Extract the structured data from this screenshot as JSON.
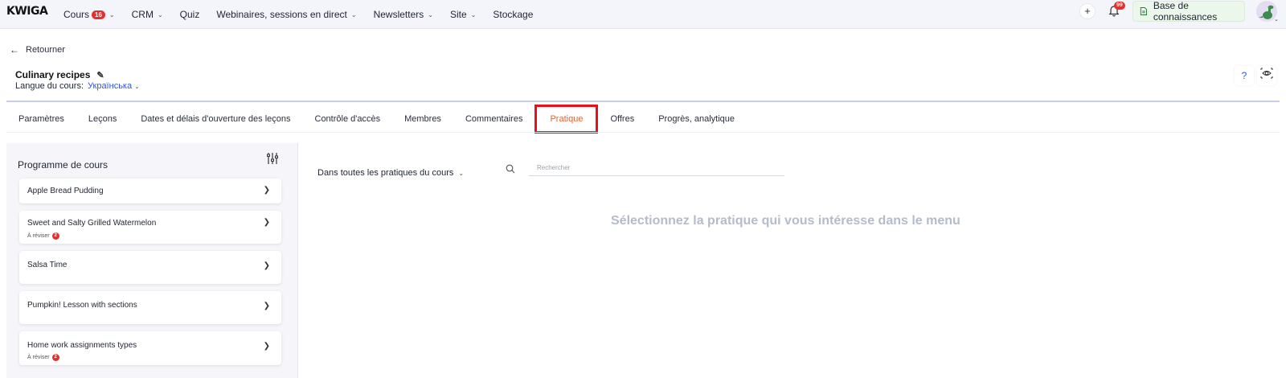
{
  "app": {
    "logo": "KWIGA"
  },
  "nav": {
    "items": [
      {
        "label": "Cours",
        "badge": "16",
        "has_chevron": true
      },
      {
        "label": "CRM",
        "has_chevron": true
      },
      {
        "label": "Quiz",
        "has_chevron": false
      },
      {
        "label": "Webinaires, sessions en direct",
        "has_chevron": true
      },
      {
        "label": "Newsletters",
        "has_chevron": true
      },
      {
        "label": "Site",
        "has_chevron": true
      },
      {
        "label": "Stockage",
        "has_chevron": false
      }
    ],
    "plus_label": "+",
    "notifications_badge": "99",
    "knowledge_base_label": "Base de connaissances"
  },
  "header": {
    "back_label": "Retourner",
    "course_title": "Culinary recipes",
    "language_label": "Langue du cours:",
    "language_value": "Українська",
    "help_label": "?"
  },
  "tabs": [
    {
      "label": "Paramètres",
      "active": false
    },
    {
      "label": "Leçons",
      "active": false
    },
    {
      "label": "Dates et délais d'ouverture des leçons",
      "active": false
    },
    {
      "label": "Contrôle d'accès",
      "active": false
    },
    {
      "label": "Membres",
      "active": false
    },
    {
      "label": "Commentaires",
      "active": false
    },
    {
      "label": "Pratique",
      "active": true
    },
    {
      "label": "Offres",
      "active": false
    },
    {
      "label": "Progrès, analytique",
      "active": false
    }
  ],
  "program": {
    "title": "Programme de cours",
    "lessons": [
      {
        "name": "Apple Bread Pudding",
        "review_label": "",
        "review_count": ""
      },
      {
        "name": "Sweet and Salty Grilled Watermelon",
        "review_label": "À réviser",
        "review_count": "2"
      },
      {
        "name": "Salsa Time",
        "review_label": "",
        "review_count": ""
      },
      {
        "name": "Pumpkin! Lesson with sections",
        "review_label": "",
        "review_count": ""
      },
      {
        "name": "Home work assignments types",
        "review_label": "À réviser",
        "review_count": "2"
      }
    ]
  },
  "practice": {
    "filter_label": "Dans toutes les pratiques du cours",
    "search_placeholder": "Rechercher",
    "empty_message": "Sélectionnez la pratique qui vous intéresse dans le menu"
  },
  "colors": {
    "active_tab_text": "#e8622f",
    "highlight_border": "#e8111b",
    "badge_red": "#e0312f",
    "link_blue": "#3457d5",
    "kb_button_bg": "#eaf7ea"
  }
}
